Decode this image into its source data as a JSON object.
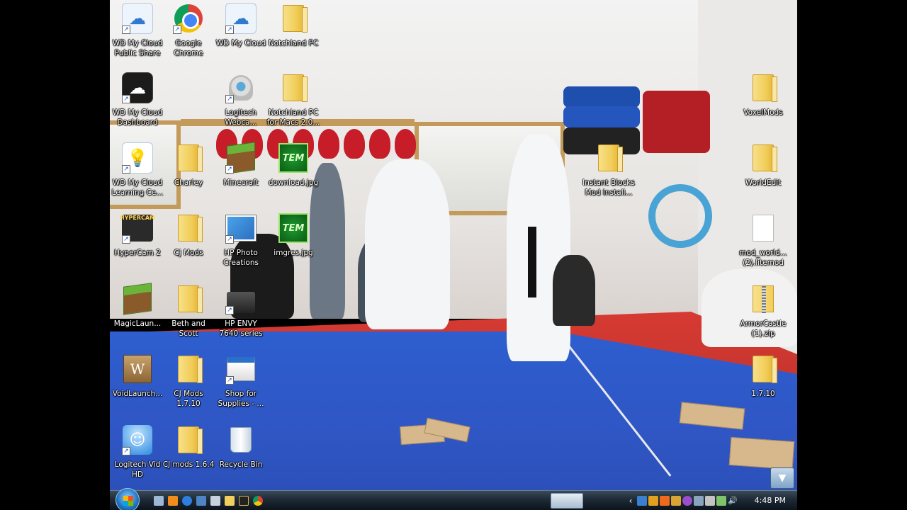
{
  "desktop": {
    "icons": [
      {
        "label": "WD My Cloud\nPublic Share",
        "icon": "wd-cloud-icon"
      },
      {
        "label": "Google\nChrome",
        "icon": "chrome-icon"
      },
      {
        "label": "WD My Cloud",
        "icon": "wd-cloud-icon"
      },
      {
        "label": "Notchland PC",
        "icon": "folder-icon"
      },
      {
        "label": "WD My Cloud\nDashboard",
        "icon": "wd-cloud-dark-icon"
      },
      {
        "label": "Logitech\nWebca...",
        "icon": "webcam-icon"
      },
      {
        "label": "Notchland PC\nfor Macs 2.0...",
        "icon": "folder-icon"
      },
      {
        "label": "WD My Cloud\nLearning Ce...",
        "icon": "lightbulb-icon"
      },
      {
        "label": "Charley",
        "icon": "folder-icon"
      },
      {
        "label": "Minecraft",
        "icon": "minecraft-icon"
      },
      {
        "label": "download.jpg",
        "icon": "tem-image-icon"
      },
      {
        "label": "HyperCam 2",
        "icon": "hypercam-icon"
      },
      {
        "label": "CJ Mods",
        "icon": "folder-icon"
      },
      {
        "label": "HP Photo\nCreations",
        "icon": "photo-icon"
      },
      {
        "label": "imgres.jpg",
        "icon": "tem-image-icon"
      },
      {
        "label": "MagicLaun...",
        "icon": "minecraft-icon"
      },
      {
        "label": "Beth and\nScott",
        "icon": "folder-icon"
      },
      {
        "label": "HP ENVY\n7640 series",
        "icon": "printer-icon"
      },
      {
        "label": "VoidLaunch...",
        "icon": "void-launcher-icon"
      },
      {
        "label": "CJ Mods\n1.7.10",
        "icon": "folder-icon"
      },
      {
        "label": "Shop for\nSupplies - ...",
        "icon": "printer-shop-icon"
      },
      {
        "label": "Logitech Vid\nHD",
        "icon": "logitech-vid-icon"
      },
      {
        "label": "CJ mods 1.6.4",
        "icon": "folder-icon"
      },
      {
        "label": "Recycle Bin",
        "icon": "recycle-bin-icon"
      },
      {
        "label": "VoxelMods",
        "icon": "folder-icon"
      },
      {
        "label": "WorldEdit",
        "icon": "folder-icon"
      },
      {
        "label": "Instant Blocks\nMod Install...",
        "icon": "folder-icon"
      },
      {
        "label": "mod_world...\n(2).litemod",
        "icon": "document-icon"
      },
      {
        "label": "ArmorCastle\n(1).zip",
        "icon": "zip-folder-icon"
      },
      {
        "label": "1.7.10",
        "icon": "folder-icon"
      }
    ]
  },
  "taskbar": {
    "clock": "4:48 PM",
    "quick_launch": [
      "show-desktop-icon",
      "media-player-icon",
      "ie-icon",
      "window-icon",
      "app-icon",
      "folder-icon",
      "batman-icon",
      "chrome-icon"
    ],
    "tray_icons": [
      "chevron-left-icon",
      "network-icon",
      "security-icon",
      "orange-icon",
      "app-icon",
      "purple-icon",
      "wifi-icon",
      "pen-icon",
      "battery-icon",
      "volume-icon"
    ]
  },
  "colors": {
    "taskbar_bg": "#1e2a36",
    "floor_blue": "#2f56c4",
    "floor_red": "#c4352e",
    "wall": "#ebe9e7"
  }
}
